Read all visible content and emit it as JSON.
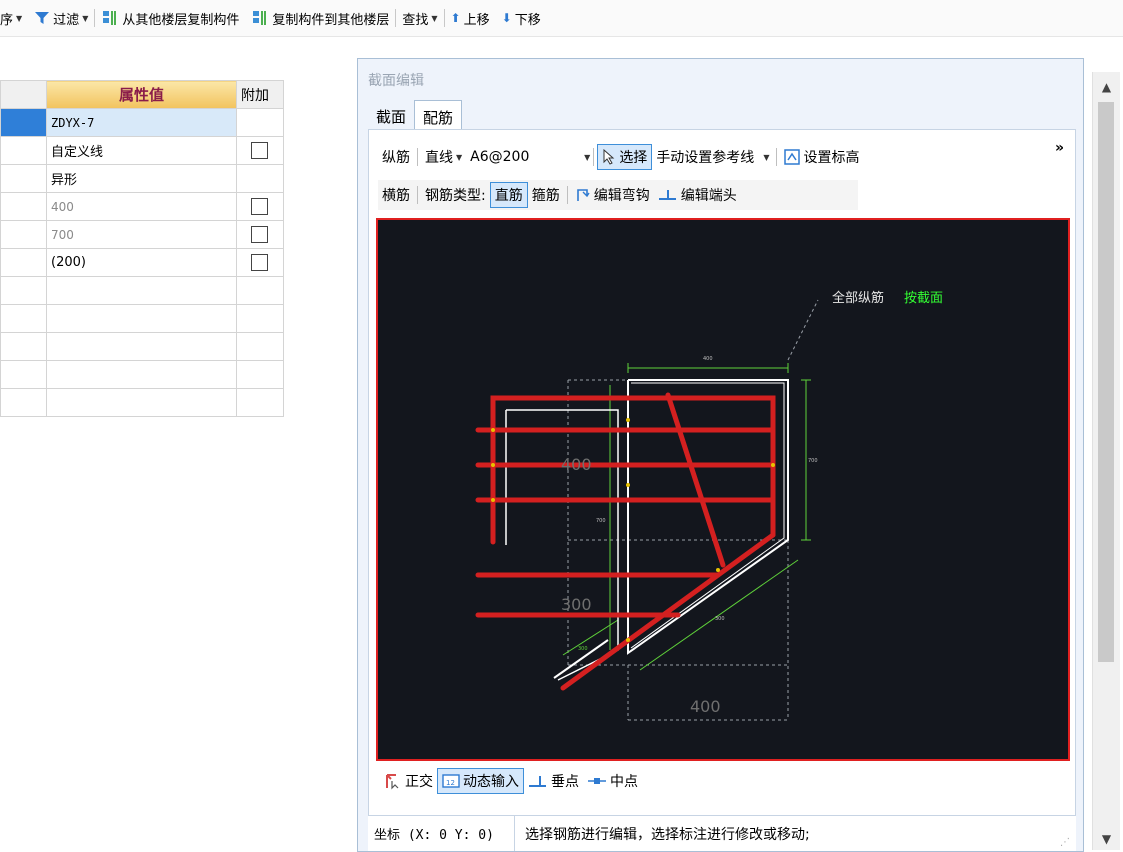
{
  "toolbar": {
    "partial_label": "序",
    "filter_label": "过滤",
    "copy_from_floors": "从其他楼层复制构件",
    "copy_to_floors": "复制构件到其他楼层",
    "find_label": "查找",
    "move_up": "上移",
    "move_down": "下移"
  },
  "grid": {
    "header_value": "属性值",
    "header_add": "附加",
    "rows": [
      {
        "value": "ZDYX-7",
        "checkbox": false,
        "style": "mono"
      },
      {
        "value": "自定义线",
        "checkbox": true,
        "style": "normal"
      },
      {
        "value": "异形",
        "checkbox": false,
        "style": "normal"
      },
      {
        "value": "400",
        "checkbox": true,
        "style": "gray"
      },
      {
        "value": "700",
        "checkbox": true,
        "style": "gray"
      },
      {
        "value": "(200)",
        "checkbox": true,
        "style": "normal"
      },
      {
        "value": "",
        "checkbox": false,
        "style": "normal"
      },
      {
        "value": "",
        "checkbox": false,
        "style": "normal"
      },
      {
        "value": "",
        "checkbox": false,
        "style": "normal"
      },
      {
        "value": "",
        "checkbox": false,
        "style": "normal"
      },
      {
        "value": "",
        "checkbox": false,
        "style": "normal"
      }
    ]
  },
  "dialog": {
    "title": "截面编辑",
    "tabs": [
      "截面",
      "配筋"
    ],
    "active_tab": "配筋",
    "row1": {
      "longitudinal": "纵筋",
      "line_type": "直线",
      "rebar_spec": "A6@200",
      "select": "选择",
      "set_ref_line": "手动设置参考线",
      "set_elevation": "设置标高",
      "more": "»"
    },
    "row2": {
      "transverse": "横筋",
      "rebar_type_label": "钢筋类型:",
      "straight": "直筋",
      "stirrup": "箍筋",
      "edit_hook": "编辑弯钩",
      "edit_end": "编辑端头"
    },
    "canvas": {
      "annotation_label": "全部纵筋",
      "annotation_value": "按截面",
      "dim_labels": [
        "400",
        "300",
        "400",
        "400",
        "700",
        "700",
        "300",
        "300"
      ],
      "colors": {
        "background": "#13161d",
        "rebar": "#d42020",
        "outline": "#ffffff",
        "dimension": "#5fd23a",
        "annotation_green": "#33ff33"
      }
    },
    "row3": {
      "ortho": "正交",
      "dynamic_input": "动态输入",
      "perpendicular": "垂点",
      "midpoint": "中点"
    },
    "status": {
      "coords": "坐标 (X: 0 Y: 0)",
      "message": "选择钢筋进行编辑，选择标注进行修改或移动;"
    }
  }
}
